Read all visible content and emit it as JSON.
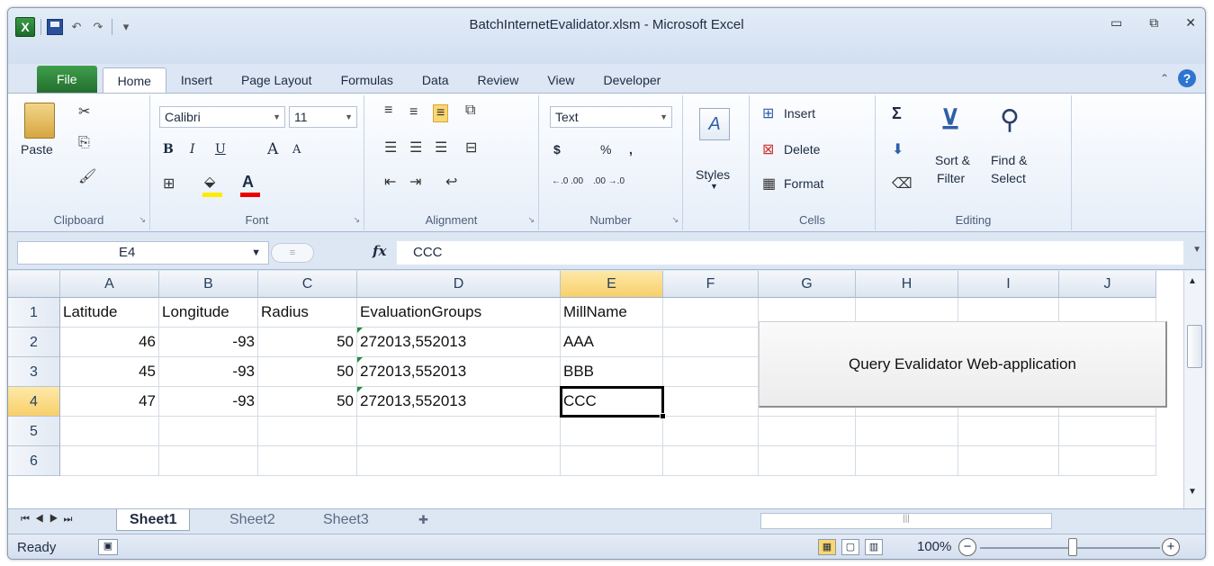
{
  "window": {
    "title": "BatchInternetEvalidator.xlsm - Microsoft Excel"
  },
  "qat": {
    "undo": "↶",
    "redo": "↷",
    "dropdown": "▾"
  },
  "window_controls": {
    "minimize": "▭",
    "restore": "⧉",
    "close": "✕"
  },
  "tabs": [
    "File",
    "Home",
    "Insert",
    "Page Layout",
    "Formulas",
    "Data",
    "Review",
    "View",
    "Developer"
  ],
  "ribbon": {
    "clipboard": {
      "paste": "Paste",
      "label": "Clipboard"
    },
    "font": {
      "name": "Calibri",
      "size": "11",
      "bold": "B",
      "italic": "I",
      "underline": "U",
      "grow": "A",
      "shrink": "A",
      "color": "A",
      "label": "Font"
    },
    "alignment": {
      "label": "Alignment"
    },
    "number": {
      "format": "Text",
      "currency": "$",
      "percent": "%",
      "comma": ",",
      "inc_decimal": "←.0 .00",
      "dec_decimal": ".00 →.0",
      "label": "Number"
    },
    "styles": {
      "label": "Styles"
    },
    "cells": {
      "insert": "Insert",
      "delete": "Delete",
      "format": "Format",
      "label": "Cells"
    },
    "editing": {
      "sum": "Σ",
      "sort_filter_1": "Sort &",
      "sort_filter_2": "Filter",
      "find_select_1": "Find &",
      "find_select_2": "Select",
      "label": "Editing"
    }
  },
  "formula_bar": {
    "name_box": "E4",
    "fx": "fx",
    "value": "CCC"
  },
  "columns": [
    "A",
    "B",
    "C",
    "D",
    "E",
    "F",
    "G",
    "H",
    "I",
    "J"
  ],
  "rows": [
    "1",
    "2",
    "3",
    "4",
    "5",
    "6"
  ],
  "cells": {
    "header": [
      "Latitude",
      "Longitude",
      "Radius",
      "EvaluationGroups",
      "MillName"
    ],
    "r2": [
      "46",
      "-93",
      "50",
      "272013,552013",
      "AAA"
    ],
    "r3": [
      "45",
      "-93",
      "50",
      "272013,552013",
      "BBB"
    ],
    "r4": [
      "47",
      "-93",
      "50",
      "272013,552013",
      "CCC"
    ]
  },
  "selected_cell": "E4",
  "query_button": "Query Evalidator Web-application",
  "sheets": [
    "Sheet1",
    "Sheet2",
    "Sheet3"
  ],
  "status": {
    "ready": "Ready",
    "zoom": "100%"
  }
}
